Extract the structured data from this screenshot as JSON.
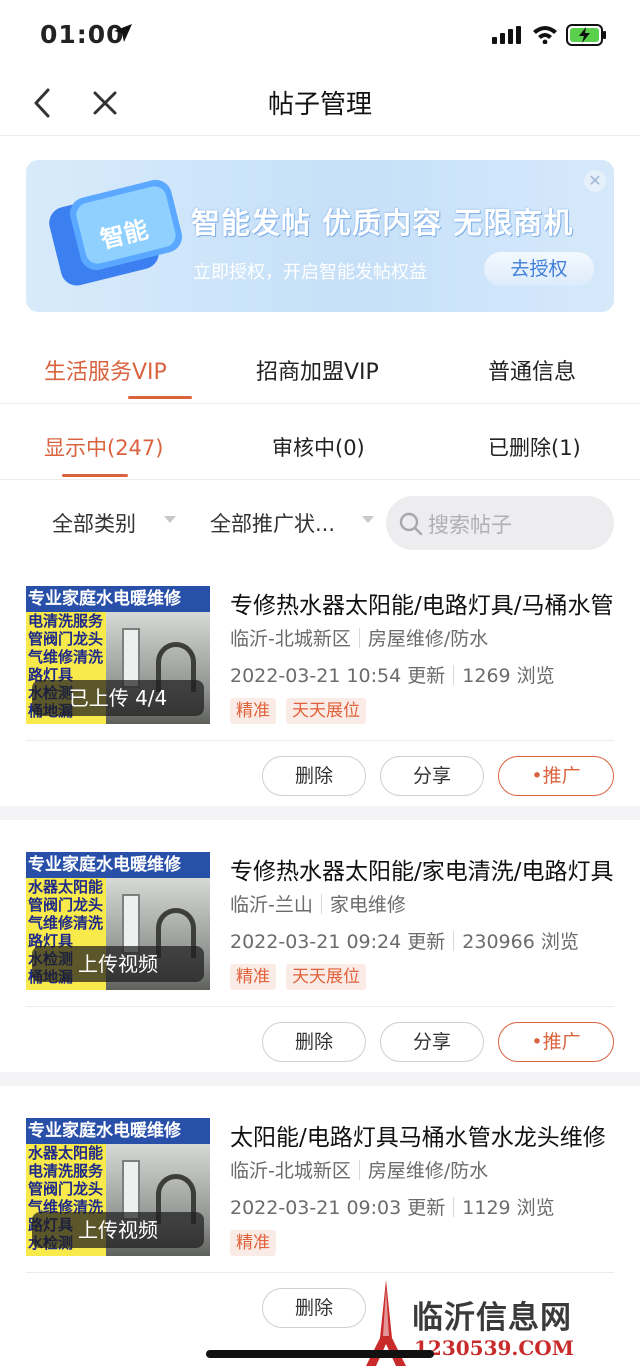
{
  "status": {
    "time": "01:00"
  },
  "nav": {
    "title": "帖子管理"
  },
  "banner": {
    "badge": "智能",
    "headline": "智能发帖 优质内容 无限商机",
    "sub": "立即授权，开启智能发帖权益",
    "button": "去授权"
  },
  "tabs_primary": [
    "生活服务VIP",
    "招商加盟VIP",
    "普通信息"
  ],
  "tabs_secondary": [
    "显示中(247)",
    "审核中(0)",
    "已删除(1)"
  ],
  "filters": {
    "category": "全部类别",
    "promo_status": "全部推广状...",
    "search_placeholder": "搜索帖子"
  },
  "posts": [
    {
      "thumb_header": "专业家庭水电暖维修",
      "thumb_text": "电清洗服务\n管阀门龙头\n气维修清洗\n路灯具\n水检测\n桶地漏",
      "thumb_overlay": "已上传 4/4",
      "title": "专修热水器太阳能/电路灯具/马桶水管",
      "location": "临沂-北城新区",
      "category": "房屋维修/防水",
      "updated": "2022-03-21 10:54 更新",
      "views": "1269 浏览",
      "tags": [
        "精准",
        "天天展位"
      ],
      "actions": [
        "删除",
        "分享",
        "•推广"
      ]
    },
    {
      "thumb_header": "专业家庭水电暖维修",
      "thumb_text": "水器太阳能\n管阀门龙头\n气维修清洗\n路灯具\n水检测\n桶地漏",
      "thumb_overlay": "上传视频",
      "title": "专修热水器太阳能/家电清洗/电路灯具",
      "location": "临沂-兰山",
      "category": "家电维修",
      "updated": "2022-03-21 09:24 更新",
      "views": "230966 浏览",
      "tags": [
        "精准",
        "天天展位"
      ],
      "actions": [
        "删除",
        "分享",
        "•推广"
      ]
    },
    {
      "thumb_header": "专业家庭水电暖维修",
      "thumb_text": "水器太阳能\n电清洗服务\n管阀门龙头\n气维修清洗\n路灯具\n水检测",
      "thumb_overlay": "上传视频",
      "title": "太阳能/电路灯具马桶水管水龙头维修",
      "location": "临沂-北城新区",
      "category": "房屋维修/防水",
      "updated": "2022-03-21 09:03 更新",
      "views": "1129 浏览",
      "tags": [
        "精准"
      ],
      "actions": [
        "删除"
      ]
    }
  ],
  "watermark": {
    "title": "临沂信息网",
    "url": "1230539.COM"
  },
  "colors": {
    "accent": "#d9633f",
    "tag_bg": "#fbebe6",
    "banner_bg": "#c6e0f8"
  }
}
